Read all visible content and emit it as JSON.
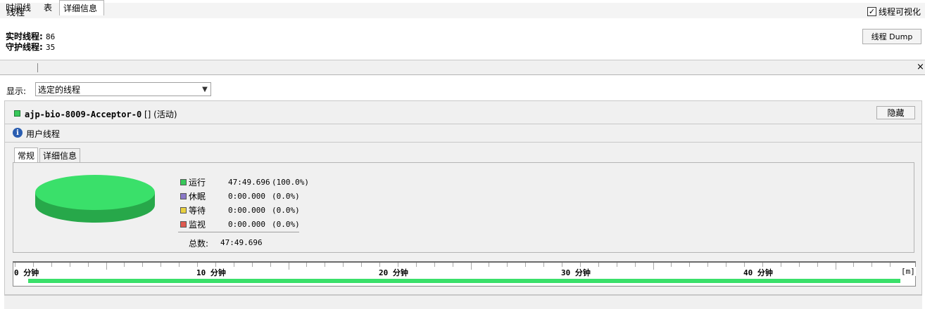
{
  "header": {
    "title": "线程",
    "visualize_label": "线程可视化",
    "visualize_checked": true,
    "live_threads_label": "实时线程:",
    "live_threads_value": "86",
    "daemon_threads_label": "守护线程:",
    "daemon_threads_value": "35",
    "dump_button": "线程 Dump"
  },
  "tabs": {
    "timeline": "时间线",
    "table": "表",
    "details": "详细信息",
    "close": "×"
  },
  "filter": {
    "label": "显示:",
    "selected": "选定的线程"
  },
  "thread": {
    "name": "ajp-bio-8009-Acceptor-0",
    "suffix": "[] (活动)",
    "hide_button": "隐藏",
    "type_label": "用户线程",
    "icon": "info-icon"
  },
  "inner_tabs": {
    "general": "常规",
    "details": "详细信息"
  },
  "states": [
    {
      "name": "运行",
      "time": "47:49.696",
      "percent": "(100.0%)",
      "color": "#38c85a"
    },
    {
      "name": "休眠",
      "time": "0:00.000",
      "percent": "(0.0%)",
      "color": "#8a78c8"
    },
    {
      "name": "等待",
      "time": "0:00.000",
      "percent": "(0.0%)",
      "color": "#e8d040"
    },
    {
      "name": "监视",
      "time": "0:00.000",
      "percent": "(0.0%)",
      "color": "#e05a50"
    }
  ],
  "total": {
    "label": "总数:",
    "value": "47:49.696"
  },
  "timeline": {
    "labels": [
      "0 分钟",
      "10 分钟",
      "20 分钟",
      "30 分钟",
      "40 分钟"
    ],
    "unit": "[m]",
    "running_fraction": 1.0
  }
}
